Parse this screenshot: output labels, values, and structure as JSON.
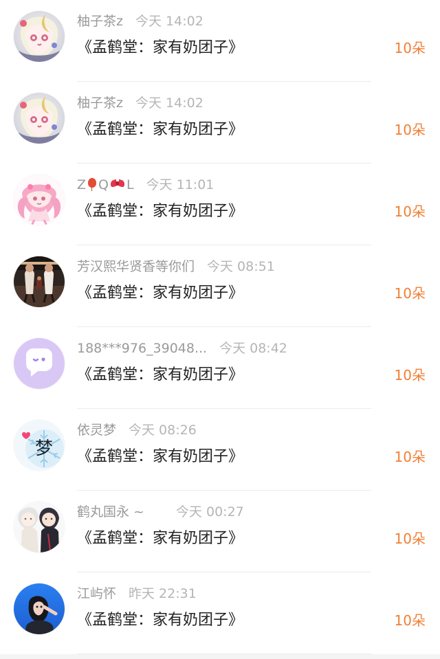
{
  "list": {
    "items": [
      {
        "name": "柚子茶z",
        "time": "今天 14:02",
        "title": "《孟鹤堂：家有奶团子》",
        "count": "10朵",
        "avatar_icon": "anime-girl-crescent-avatar"
      },
      {
        "name": "柚子茶z",
        "time": "今天 14:02",
        "title": "《孟鹤堂：家有奶团子》",
        "count": "10朵",
        "avatar_icon": "anime-girl-crescent-avatar"
      },
      {
        "name_prefix": "Z",
        "name_middle": "Q",
        "name_suffix": "L",
        "name_emojis": [
          "balloon-icon",
          "ribbon-bow-icon"
        ],
        "time": "今天 11:01",
        "title": "《孟鹤堂：家有奶团子》",
        "count": "10朵",
        "avatar_icon": "pink-hair-chibi-avatar"
      },
      {
        "name": "芳汉熙华贤香等你们",
        "time": "今天 08:51",
        "title": "《孟鹤堂：家有奶团子》",
        "count": "10朵",
        "avatar_icon": "stage-performers-avatar"
      },
      {
        "name": "188***976_39048...",
        "time": "今天 08:42",
        "title": "《孟鹤堂：家有奶团子》",
        "count": "10朵",
        "avatar_icon": "purple-chat-bubble-avatar"
      },
      {
        "name": "依灵梦",
        "time": "今天 08:26",
        "title": "《孟鹤堂：家有奶团子》",
        "count": "10朵",
        "avatar_icon": "snowflake-dream-avatar",
        "avatar_text": "梦"
      },
      {
        "name": "鹤丸国永 ~",
        "time": "今天 00:27",
        "title": "《孟鹤堂：家有奶团子》",
        "count": "10朵",
        "avatar_icon": "two-anime-boys-avatar"
      },
      {
        "name": "江屿怀",
        "time": "昨天 22:31",
        "title": "《孟鹤堂：家有奶团子》",
        "count": "10朵",
        "avatar_icon": "girl-blue-sky-avatar"
      }
    ]
  },
  "colors": {
    "accent": "#f17f34",
    "name_text": "#9a9a9a",
    "time_text": "#b5b5b5",
    "title_text": "#222222",
    "background": "#f4f4f4",
    "card": "#ffffff"
  }
}
